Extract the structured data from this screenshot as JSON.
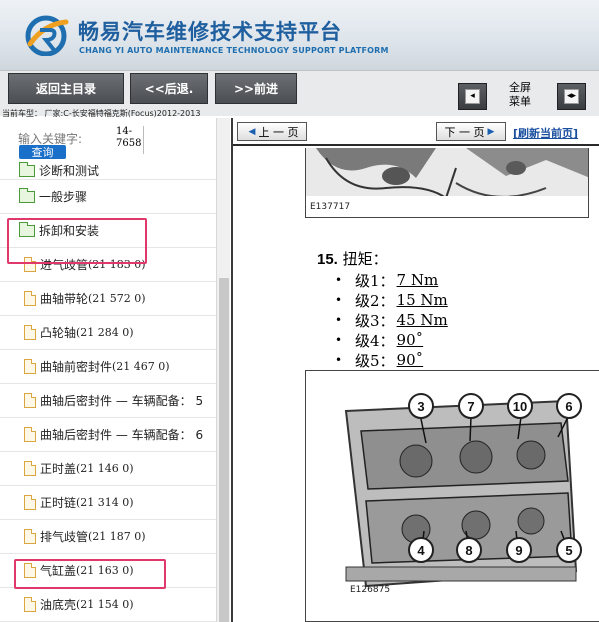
{
  "brand": {
    "title_cn": "畅易汽车维修技术支持平台",
    "title_en": "CHANG YI AUTO MAINTENANCE TECHNOLOGY SUPPORT PLATFORM"
  },
  "toolbar": {
    "home_label": "返回主目录",
    "back_label": "<<后退.",
    "forward_label": ">>前进",
    "fullscreen_line1": "全屏",
    "fullscreen_line2": "菜单",
    "vehicle_info": "当前车型：  厂家:C-长安福特福克斯(Focus)2012-2013"
  },
  "sidebar": {
    "keyword_label": "输入关键字:",
    "keyword_value_line1": "14-",
    "keyword_value_line2": "7658",
    "query_label": "查询",
    "items": [
      {
        "type": "folder",
        "label": "诊断和测试"
      },
      {
        "type": "folder",
        "label": "一般步骤"
      },
      {
        "type": "folder",
        "label": "拆卸和安装"
      },
      {
        "type": "file",
        "label": "进气歧管",
        "code": "(21 183 0)"
      },
      {
        "type": "file",
        "label": "曲轴带轮",
        "code": "(21 572 0)"
      },
      {
        "type": "file",
        "label": "凸轮轴",
        "code": "(21 284 0)"
      },
      {
        "type": "file",
        "label": "曲轴前密封件",
        "code": "(21 467 0)"
      },
      {
        "type": "file",
        "label": "曲轴后密封件 — 车辆配备： 5",
        "code": ""
      },
      {
        "type": "file",
        "label": "曲轴后密封件 — 车辆配备： 6",
        "code": ""
      },
      {
        "type": "file",
        "label": "正时盖",
        "code": "(21 146 0)"
      },
      {
        "type": "file",
        "label": "正时链",
        "code": "(21 314 0)"
      },
      {
        "type": "file",
        "label": "排气歧管",
        "code": "(21 187 0)"
      },
      {
        "type": "file",
        "label": "气缸盖",
        "code": "(21 163 0)"
      },
      {
        "type": "file",
        "label": "油底壳",
        "code": "(21 154 0)"
      }
    ]
  },
  "content": {
    "prev_label": "上 一 页",
    "next_label": "下 一 页",
    "refresh_label": "[刷新当前页]",
    "figure1_id": "E137717",
    "figure2_id": "E126875",
    "step_number": "15.",
    "step_title": "扭矩：",
    "torque": [
      {
        "level": "级1：",
        "value": "7 Nm"
      },
      {
        "level": "级2：",
        "value": "15 Nm"
      },
      {
        "level": "级3：",
        "value": "45 Nm"
      },
      {
        "level": "级4：",
        "value": "90˚"
      },
      {
        "level": "级5：",
        "value": "90˚"
      }
    ],
    "callouts_top": [
      "3",
      "7",
      "10",
      "6"
    ],
    "callouts_bottom": [
      "4",
      "8",
      "9",
      "5"
    ]
  },
  "colors": {
    "brand_blue": "#1f5f9f",
    "highlight": "#e0386a",
    "query_button": "#1a6fc9",
    "toolbar_button": "#55595d"
  }
}
